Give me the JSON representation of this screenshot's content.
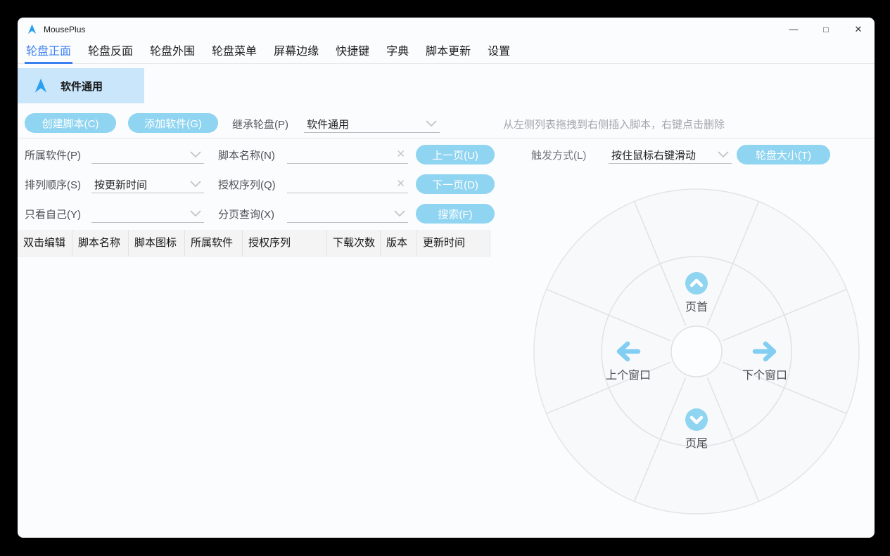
{
  "titlebar": {
    "title": "MousePlus",
    "app_icon": "cursor-triangle-icon"
  },
  "window_controls": {
    "minimize": "—",
    "maximize": "□",
    "close": "✕"
  },
  "tabs": {
    "items": [
      {
        "label": "轮盘正面",
        "active": true
      },
      {
        "label": "轮盘反面",
        "active": false
      },
      {
        "label": "轮盘外围",
        "active": false
      },
      {
        "label": "轮盘菜单",
        "active": false
      },
      {
        "label": "屏幕边缘",
        "active": false
      },
      {
        "label": "快捷键",
        "active": false
      },
      {
        "label": "字典",
        "active": false
      },
      {
        "label": "脚本更新",
        "active": false
      },
      {
        "label": "设置",
        "active": false
      }
    ]
  },
  "selected_wheel": {
    "label": "软件通用"
  },
  "toolbar": {
    "create_script": "创建脚本(C)",
    "add_software": "添加软件(G)",
    "inherit_label": "继承轮盘(P)",
    "inherit_value": "软件通用",
    "hint": "从左侧列表拖拽到右侧插入脚本，右键点击删除"
  },
  "filters": {
    "rows": [
      {
        "label1": "所属软件(P)",
        "value1": "",
        "label2": "脚本名称(N)",
        "value2": "",
        "button": "上一页(U)"
      },
      {
        "label1": "排列顺序(S)",
        "value1": "按更新时间",
        "label2": "授权序列(Q)",
        "value2": "",
        "button": "下一页(D)"
      },
      {
        "label1": "只看自己(Y)",
        "value1": "",
        "label2": "分页查询(X)",
        "value2": "",
        "button": "搜索(F)"
      }
    ]
  },
  "trigger": {
    "label": "触发方式(L)",
    "value": "按住鼠标右键滑动",
    "wheel_size_button": "轮盘大小(T)"
  },
  "table": {
    "headers": [
      "双击编辑",
      "脚本名称",
      "脚本图标",
      "所属软件",
      "授权序列",
      "下载次数",
      "版本",
      "更新时间"
    ],
    "rows": []
  },
  "wheel": {
    "top": "页首",
    "left": "上个窗口",
    "right": "下个窗口",
    "bottom": "页尾"
  },
  "colors": {
    "accent_tab": "#3a7ff0",
    "pill_blue": "#8fd4f1",
    "selected_bg": "#c9e6fb",
    "icon_blue": "#2aa0f2",
    "wheel_line": "#e0e2e4"
  }
}
